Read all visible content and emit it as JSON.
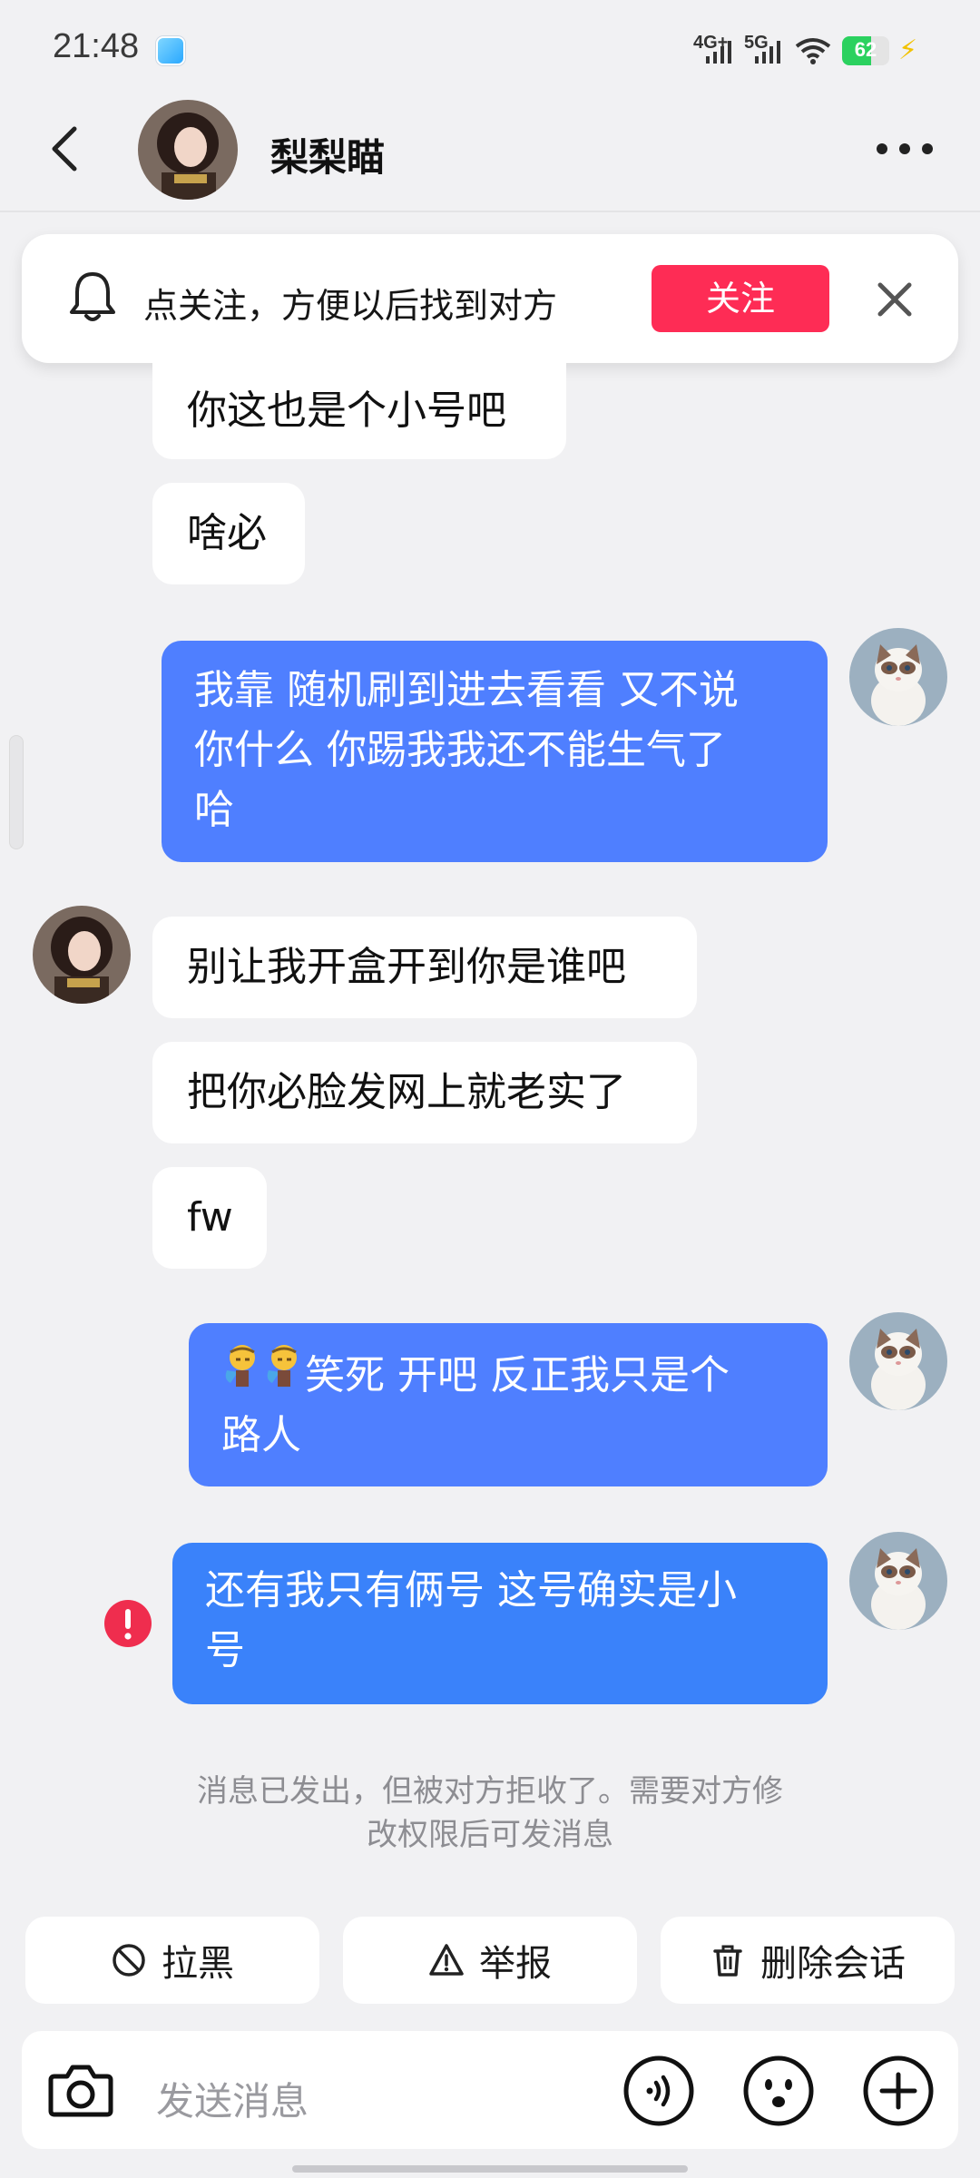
{
  "status_bar": {
    "time": "21:48",
    "network_1": "4G+",
    "network_2": "5G",
    "battery_percent": "62",
    "battery_level": 0.62,
    "charging": true
  },
  "header": {
    "contact_name": "梨梨瞄",
    "back_icon": "chevron-left-icon",
    "more_icon": "more-horizontal-icon"
  },
  "follow_banner": {
    "text": "点关注，方便以后找到对方",
    "button_label": "关注",
    "button_color": "#fe2c55"
  },
  "messages": [
    {
      "from": "them",
      "text": "你这也是个小号吧"
    },
    {
      "from": "them",
      "text": "啥必"
    },
    {
      "from": "me",
      "lines": [
        "我靠  随机刷到进去看看 又不说",
        "你什么  你踢我我还不能生气了",
        "哈"
      ]
    },
    {
      "from": "them",
      "text": "别让我开盒开到你是谁吧"
    },
    {
      "from": "them",
      "text": "把你必脸发网上就老实了"
    },
    {
      "from": "them",
      "text": "fw"
    },
    {
      "from": "me",
      "lines": [
        "笑死 开吧 反正我只是个",
        "路人"
      ],
      "emoji": "sweat-emoji"
    },
    {
      "from": "me",
      "lines": [
        "还有我只有俩号  这号确实是小",
        "号"
      ],
      "status": "failed"
    }
  ],
  "notice": {
    "line1": "消息已发出，但被对方拒收了。需要对方修",
    "line2": "改权限后可发消息"
  },
  "actions": {
    "block": "拉黑",
    "report": "举报",
    "delete": "删除会话"
  },
  "composer": {
    "placeholder": "发送消息"
  },
  "colors": {
    "accent_red": "#fe2c55",
    "bubble_me": "#4f7fff",
    "error": "#ef2d4e"
  }
}
